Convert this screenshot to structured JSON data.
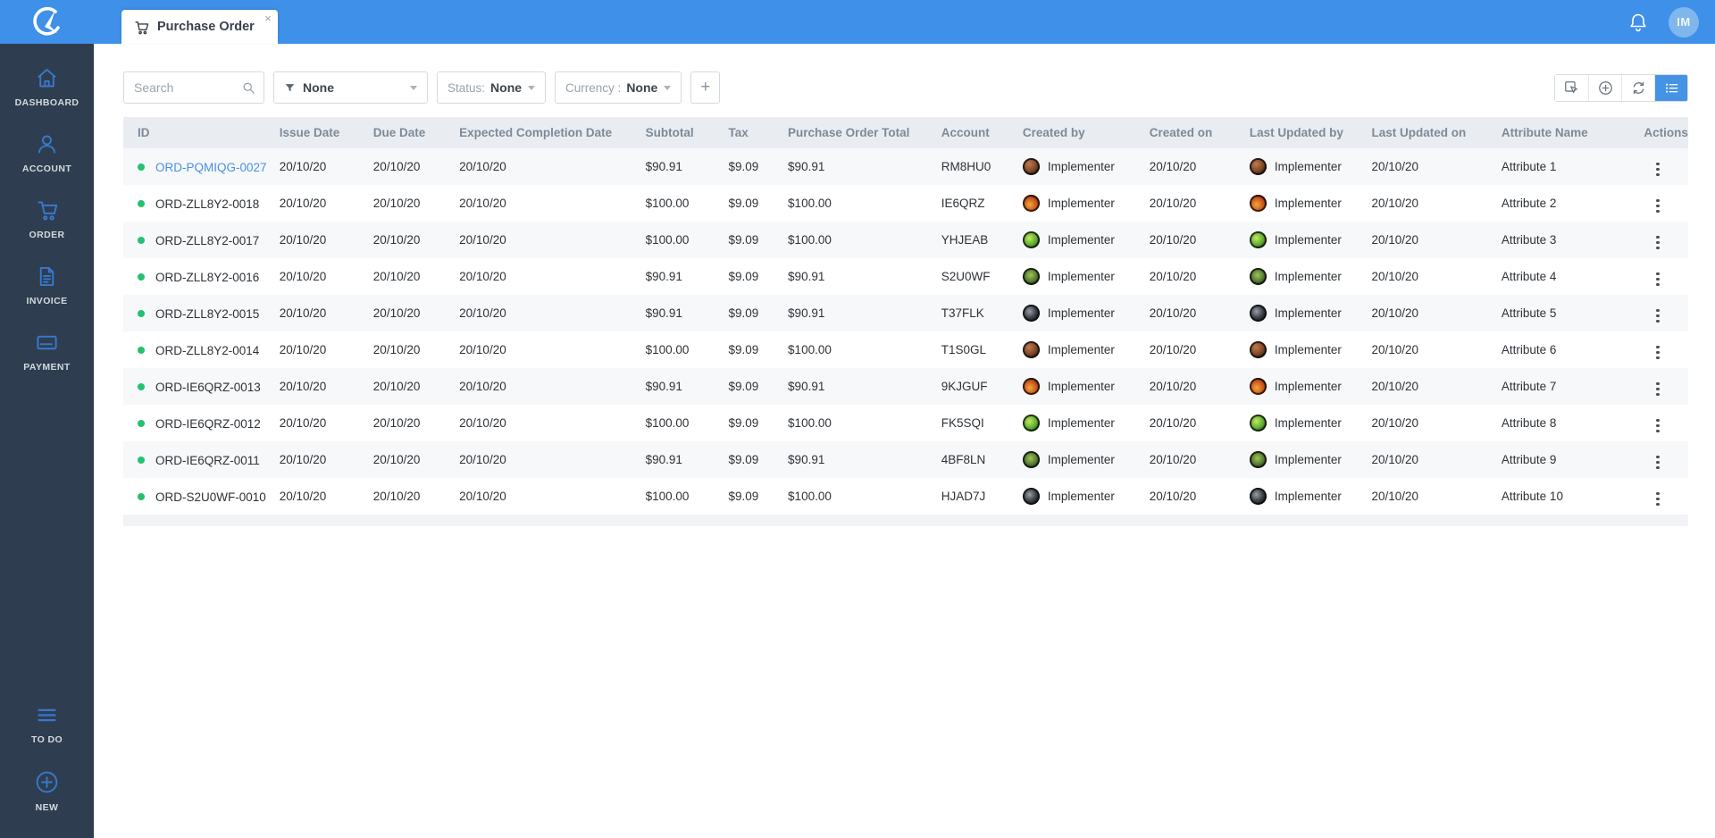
{
  "colors": {
    "accent_blue": "#3e90e8",
    "sidebar_bg": "#2e3e50",
    "sidebar_icon_blue": "#3878cc",
    "link_blue": "#4a90e2",
    "status_dot_green": "#25c16f",
    "table_header_bg": "#e9edf2",
    "row_stripe": "#f6f8fa"
  },
  "icons": {
    "logo": "compass-c-logo",
    "tab": "cart-icon",
    "topbar": [
      "bell-icon"
    ],
    "filterbar": [
      "search-icon",
      "funnel-icon",
      "chevron-down-icon",
      "plus-icon"
    ],
    "toolbar": [
      "select-cursor-icon",
      "plus-circle-icon",
      "refresh-icon",
      "list-view-icon"
    ],
    "row_actions": "kebab-menu-icon"
  },
  "topbar": {
    "tab_label": "Purchase Order",
    "tab_close": "×",
    "avatar_initials": "IM"
  },
  "sidebar": {
    "items": [
      {
        "label": "DASHBOARD"
      },
      {
        "label": "ACCOUNT"
      },
      {
        "label": "ORDER"
      },
      {
        "label": "INVOICE"
      },
      {
        "label": "PAYMENT"
      }
    ],
    "bottom_items": [
      {
        "label": "TO DO"
      },
      {
        "label": "NEW"
      }
    ]
  },
  "filters": {
    "search_placeholder": "Search",
    "filter_value": "None",
    "status_label": "Status:",
    "status_value": "None",
    "currency_label": "Currency :",
    "currency_value": "None",
    "add_button": "+"
  },
  "table": {
    "columns": [
      "ID",
      "Issue Date",
      "Due Date",
      "Expected Completion Date",
      "Subtotal",
      "Tax",
      "Purchase Order Total",
      "Account",
      "Created by",
      "Created on",
      "Last Updated by",
      "Last Updated on",
      "Attribute Name",
      "Actions"
    ],
    "rows": [
      {
        "id": "ORD-PQMIQG-0027",
        "id_link": true,
        "issue_date": "20/10/20",
        "due_date": "20/10/20",
        "expected_completion_date": "20/10/20",
        "subtotal": "$90.91",
        "tax": "$9.09",
        "total": "$90.91",
        "account": "RM8HU0",
        "created_by": "Implementer",
        "created_on": "20/10/20",
        "updated_by": "Implementer",
        "updated_on": "20/10/20",
        "attribute_name": "Attribute 1",
        "avatar_variant": 0
      },
      {
        "id": "ORD-ZLL8Y2-0018",
        "id_link": false,
        "issue_date": "20/10/20",
        "due_date": "20/10/20",
        "expected_completion_date": "20/10/20",
        "subtotal": "$100.00",
        "tax": "$9.09",
        "total": "$100.00",
        "account": "IE6QRZ",
        "created_by": "Implementer",
        "created_on": "20/10/20",
        "updated_by": "Implementer",
        "updated_on": "20/10/20",
        "attribute_name": "Attribute 2",
        "avatar_variant": 1
      },
      {
        "id": "ORD-ZLL8Y2-0017",
        "id_link": false,
        "issue_date": "20/10/20",
        "due_date": "20/10/20",
        "expected_completion_date": "20/10/20",
        "subtotal": "$100.00",
        "tax": "$9.09",
        "total": "$100.00",
        "account": "YHJEAB",
        "created_by": "Implementer",
        "created_on": "20/10/20",
        "updated_by": "Implementer",
        "updated_on": "20/10/20",
        "attribute_name": "Attribute 3",
        "avatar_variant": 2
      },
      {
        "id": "ORD-ZLL8Y2-0016",
        "id_link": false,
        "issue_date": "20/10/20",
        "due_date": "20/10/20",
        "expected_completion_date": "20/10/20",
        "subtotal": "$90.91",
        "tax": "$9.09",
        "total": "$90.91",
        "account": "S2U0WF",
        "created_by": "Implementer",
        "created_on": "20/10/20",
        "updated_by": "Implementer",
        "updated_on": "20/10/20",
        "attribute_name": "Attribute 4",
        "avatar_variant": 3
      },
      {
        "id": "ORD-ZLL8Y2-0015",
        "id_link": false,
        "issue_date": "20/10/20",
        "due_date": "20/10/20",
        "expected_completion_date": "20/10/20",
        "subtotal": "$90.91",
        "tax": "$9.09",
        "total": "$90.91",
        "account": "T37FLK",
        "created_by": "Implementer",
        "created_on": "20/10/20",
        "updated_by": "Implementer",
        "updated_on": "20/10/20",
        "attribute_name": "Attribute 5",
        "avatar_variant": 4
      },
      {
        "id": "ORD-ZLL8Y2-0014",
        "id_link": false,
        "issue_date": "20/10/20",
        "due_date": "20/10/20",
        "expected_completion_date": "20/10/20",
        "subtotal": "$100.00",
        "tax": "$9.09",
        "total": "$100.00",
        "account": "T1S0GL",
        "created_by": "Implementer",
        "created_on": "20/10/20",
        "updated_by": "Implementer",
        "updated_on": "20/10/20",
        "attribute_name": "Attribute 6",
        "avatar_variant": 0
      },
      {
        "id": "ORD-IE6QRZ-0013",
        "id_link": false,
        "issue_date": "20/10/20",
        "due_date": "20/10/20",
        "expected_completion_date": "20/10/20",
        "subtotal": "$90.91",
        "tax": "$9.09",
        "total": "$90.91",
        "account": "9KJGUF",
        "created_by": "Implementer",
        "created_on": "20/10/20",
        "updated_by": "Implementer",
        "updated_on": "20/10/20",
        "attribute_name": "Attribute 7",
        "avatar_variant": 1
      },
      {
        "id": "ORD-IE6QRZ-0012",
        "id_link": false,
        "issue_date": "20/10/20",
        "due_date": "20/10/20",
        "expected_completion_date": "20/10/20",
        "subtotal": "$100.00",
        "tax": "$9.09",
        "total": "$100.00",
        "account": "FK5SQI",
        "created_by": "Implementer",
        "created_on": "20/10/20",
        "updated_by": "Implementer",
        "updated_on": "20/10/20",
        "attribute_name": "Attribute 8",
        "avatar_variant": 2
      },
      {
        "id": "ORD-IE6QRZ-0011",
        "id_link": false,
        "issue_date": "20/10/20",
        "due_date": "20/10/20",
        "expected_completion_date": "20/10/20",
        "subtotal": "$90.91",
        "tax": "$9.09",
        "total": "$90.91",
        "account": "4BF8LN",
        "created_by": "Implementer",
        "created_on": "20/10/20",
        "updated_by": "Implementer",
        "updated_on": "20/10/20",
        "attribute_name": "Attribute 9",
        "avatar_variant": 3
      },
      {
        "id": "ORD-S2U0WF-0010",
        "id_link": false,
        "issue_date": "20/10/20",
        "due_date": "20/10/20",
        "expected_completion_date": "20/10/20",
        "subtotal": "$100.00",
        "tax": "$9.09",
        "total": "$100.00",
        "account": "HJAD7J",
        "created_by": "Implementer",
        "created_on": "20/10/20",
        "updated_by": "Implementer",
        "updated_on": "20/10/20",
        "attribute_name": "Attribute 10",
        "avatar_variant": 4
      }
    ]
  }
}
